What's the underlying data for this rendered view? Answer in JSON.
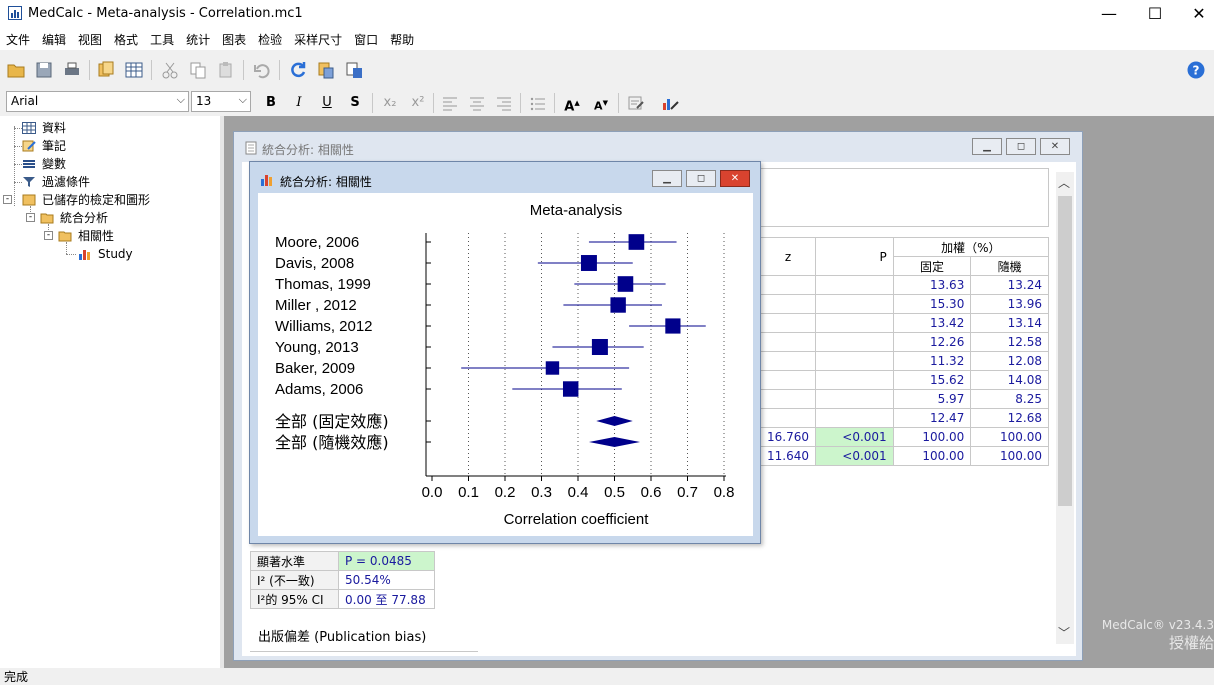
{
  "window": {
    "title": "MedCalc - Meta-analysis - Correlation.mc1",
    "minimize": "—",
    "maximize": "☐",
    "close": "✕"
  },
  "menu": [
    "文件",
    "编辑",
    "视图",
    "格式",
    "工具",
    "统计",
    "图表",
    "检验",
    "采样尺寸",
    "窗口",
    "帮助"
  ],
  "format_bar": {
    "font": "Arial",
    "size": "13",
    "bold": "B",
    "italic": "I",
    "underline": "U",
    "strike": "S",
    "subscript": "x₂",
    "superscript": "x²"
  },
  "tree": {
    "items": [
      "資料",
      "筆記",
      "變數",
      "過濾條件",
      "已儲存的檢定和圖形",
      "統合分析",
      "相關性",
      "Study"
    ]
  },
  "back_window": {
    "title": "統合分析: 相關性",
    "table": {
      "headers": {
        "z": "z",
        "p": "P",
        "weights": "加權（%）",
        "fixed": "固定",
        "random": "隨機"
      },
      "rows": [
        {
          "fixed": "13.63",
          "random": "13.24"
        },
        {
          "fixed": "15.30",
          "random": "13.96"
        },
        {
          "fixed": "13.42",
          "random": "13.14"
        },
        {
          "fixed": "12.26",
          "random": "12.58"
        },
        {
          "fixed": "11.32",
          "random": "12.08"
        },
        {
          "fixed": "15.62",
          "random": "14.08"
        },
        {
          "fixed": "5.97",
          "random": "8.25"
        },
        {
          "fixed": "12.47",
          "random": "12.68"
        }
      ],
      "totals": [
        {
          "z": "16.760",
          "p": "<0.001",
          "fixed": "100.00",
          "random": "100.00"
        },
        {
          "z": "11.640",
          "p": "<0.001",
          "fixed": "100.00",
          "random": "100.00"
        }
      ]
    },
    "heterogeneity": [
      {
        "label": "顯著水準",
        "value": "P = 0.0485"
      },
      {
        "label": "I² (不一致)",
        "value": "50.54%"
      },
      {
        "label": "I²的 95% CI",
        "value": "0.00 至 77.88"
      }
    ],
    "bias_title": "出版偏差 (Publication bias)"
  },
  "front_window": {
    "title": "統合分析: 相關性"
  },
  "chart_data": {
    "type": "forest",
    "title": "Meta-analysis",
    "xlabel": "Correlation coefficient",
    "xlim": [
      0,
      0.8
    ],
    "xticks": [
      "0.0",
      "0.1",
      "0.2",
      "0.3",
      "0.4",
      "0.5",
      "0.6",
      "0.7",
      "0.8"
    ],
    "studies": [
      {
        "name": "Moore, 2006",
        "est": 0.56,
        "lo": 0.43,
        "hi": 0.67,
        "weight": 13.24
      },
      {
        "name": "Davis, 2008",
        "est": 0.43,
        "lo": 0.29,
        "hi": 0.55,
        "weight": 13.96
      },
      {
        "name": "Thomas, 1999",
        "est": 0.53,
        "lo": 0.39,
        "hi": 0.64,
        "weight": 13.14
      },
      {
        "name": "Miller , 2012",
        "est": 0.51,
        "lo": 0.36,
        "hi": 0.63,
        "weight": 12.58
      },
      {
        "name": "Williams, 2012",
        "est": 0.66,
        "lo": 0.54,
        "hi": 0.75,
        "weight": 12.08
      },
      {
        "name": "Young, 2013",
        "est": 0.46,
        "lo": 0.33,
        "hi": 0.58,
        "weight": 14.08
      },
      {
        "name": "Baker, 2009",
        "est": 0.33,
        "lo": 0.08,
        "hi": 0.54,
        "weight": 8.25
      },
      {
        "name": "Adams, 2006",
        "est": 0.38,
        "lo": 0.22,
        "hi": 0.52,
        "weight": 12.68
      }
    ],
    "pooled": [
      {
        "name": "全部 (固定效應)",
        "est": 0.5,
        "lo": 0.45,
        "hi": 0.55
      },
      {
        "name": "全部 (隨機效應)",
        "est": 0.5,
        "lo": 0.43,
        "hi": 0.57
      }
    ],
    "colors": {
      "marker": "#00008b",
      "line": "#00008b"
    }
  },
  "watermark": {
    "version": "MedCalc® v23.4.3",
    "license": "授權給"
  },
  "status": "完成"
}
